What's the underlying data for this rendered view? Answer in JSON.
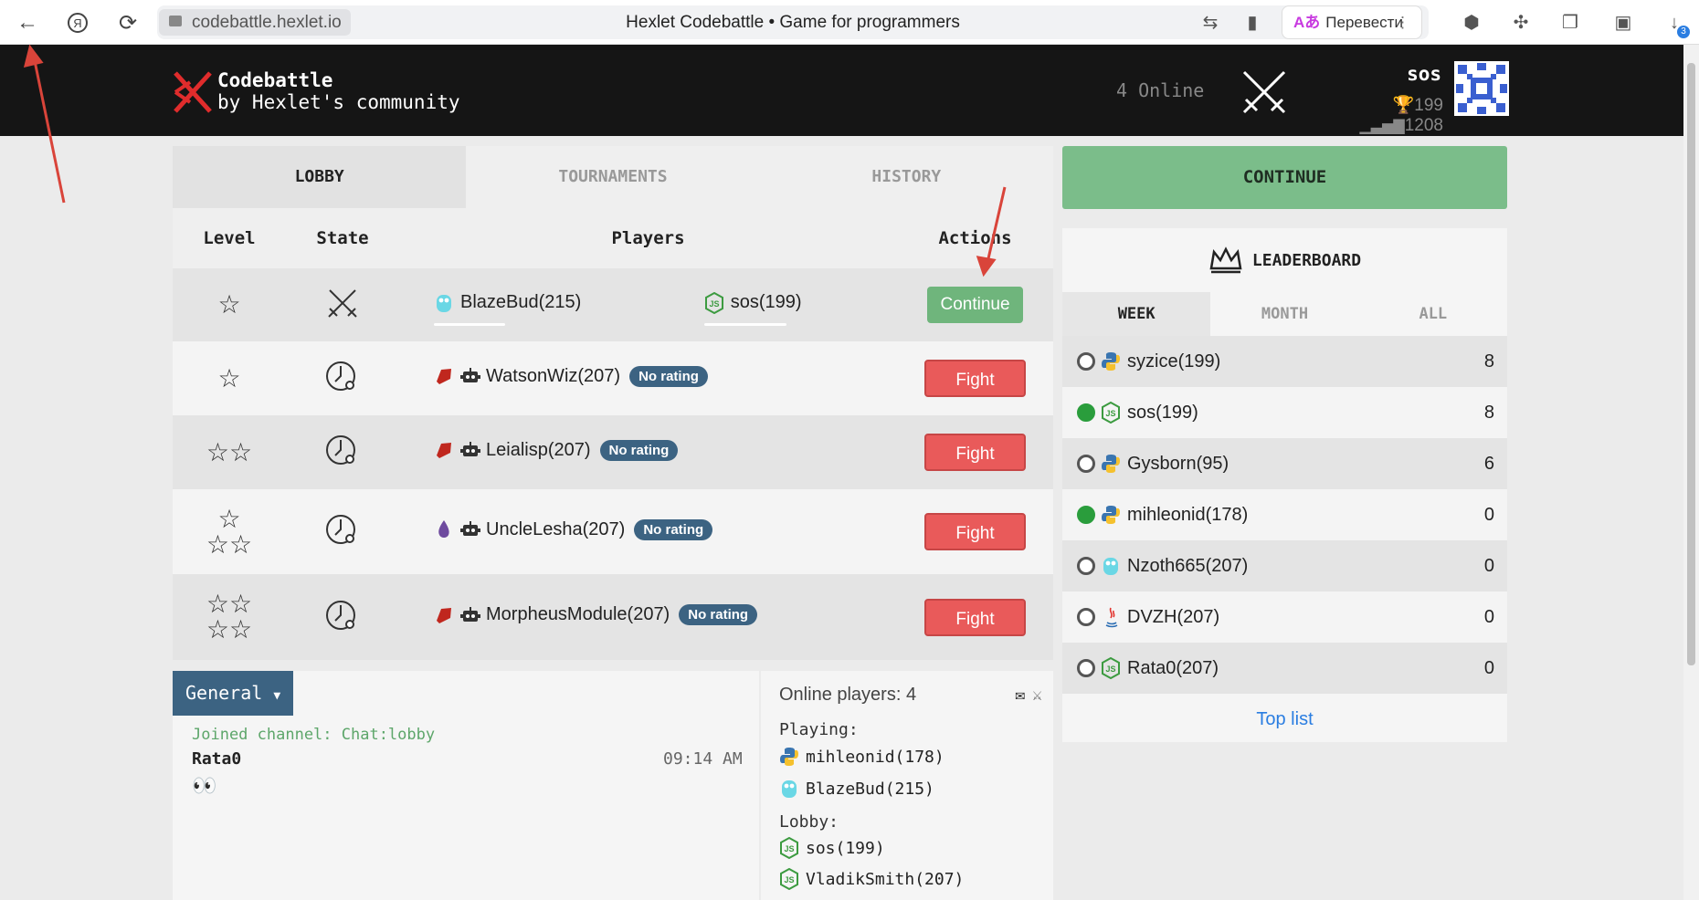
{
  "browser": {
    "url": "codebattle.hexlet.io",
    "title": "Hexlet Codebattle • Game for programmers",
    "translate_label": "Перевести",
    "downloads_badge": "3"
  },
  "header": {
    "logo_line1": "Codebattle",
    "logo_line2": "by Hexlet's community",
    "online": "4 Online",
    "username": "sos",
    "rating": "199",
    "points": "1208"
  },
  "tabs": [
    "LOBBY",
    "TOURNAMENTS",
    "HISTORY"
  ],
  "table": {
    "headers": {
      "level": "Level",
      "state": "State",
      "players": "Players",
      "actions": "Actions"
    },
    "rows": [
      {
        "p1": "BlazeBud(215)",
        "p2": "sos(199)",
        "badge": "",
        "action": "Continue"
      },
      {
        "p1": "WatsonWiz(207)",
        "badge": "No rating",
        "action": "Fight"
      },
      {
        "p1": "Leialisp(207)",
        "badge": "No rating",
        "action": "Fight"
      },
      {
        "p1": "UncleLesha(207)",
        "badge": "No rating",
        "action": "Fight"
      },
      {
        "p1": "MorpheusModule(207)",
        "badge": "No rating",
        "action": "Fight"
      }
    ]
  },
  "continue_button": "CONTINUE",
  "leaderboard": {
    "title": "LEADERBOARD",
    "tabs": [
      "WEEK",
      "MONTH",
      "ALL"
    ],
    "rows": [
      {
        "name": "syzice(199)",
        "score": "8"
      },
      {
        "name": "sos(199)",
        "score": "8"
      },
      {
        "name": "Gysborn(95)",
        "score": "6"
      },
      {
        "name": "mihleonid(178)",
        "score": "0"
      },
      {
        "name": "Nzoth665(207)",
        "score": "0"
      },
      {
        "name": "DVZH(207)",
        "score": "0"
      },
      {
        "name": "Rata0(207)",
        "score": "0"
      }
    ],
    "top_list": "Top list"
  },
  "chat": {
    "channel": "General",
    "joined": "Joined channel: Chat:lobby",
    "message_user": "Rata0",
    "message_time": "09:14 AM",
    "message_text": "👀"
  },
  "online_panel": {
    "title": "Online players: 4",
    "playing_label": "Playing:",
    "playing": [
      "mihleonid(178)",
      "BlazeBud(215)"
    ],
    "lobby_label": "Lobby:",
    "lobby": [
      "sos(199)",
      "VladikSmith(207)"
    ]
  }
}
